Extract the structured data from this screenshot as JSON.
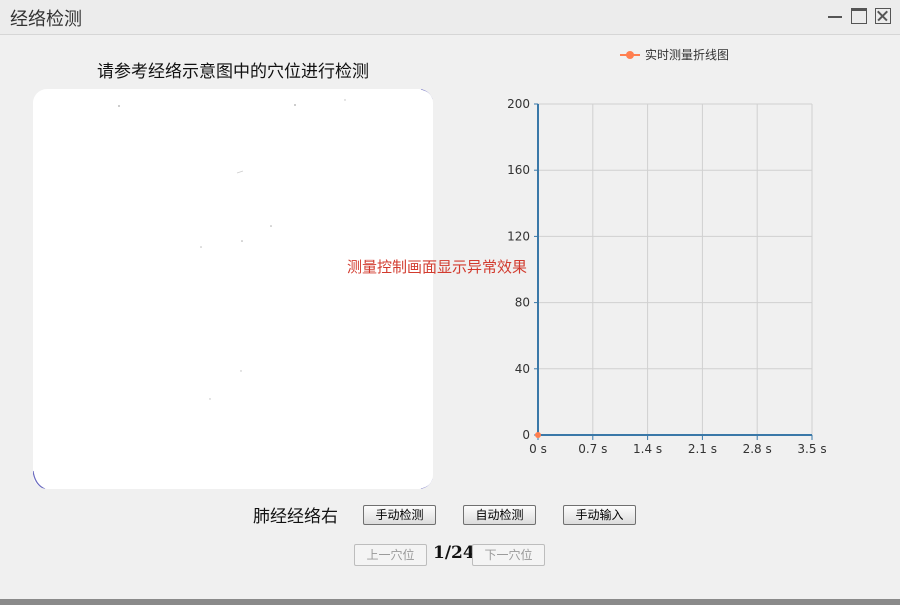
{
  "window": {
    "title": "经络检测"
  },
  "left_panel": {
    "reference_title": "请参考经络示意图中的穴位进行检测"
  },
  "error_message": "测量控制画面显示异常效果",
  "controls": {
    "meridian_label": "肺经经络右",
    "manual_detect": "手动检测",
    "auto_detect": "自动检测",
    "manual_input": "手动输入"
  },
  "navigation": {
    "prev_label": "上一穴位",
    "counter": "1/24",
    "next_label": "下一穴位"
  },
  "colors": {
    "series": "#ff7f50",
    "axis": "#3a78a8",
    "grid": "#d0d0d0",
    "error": "#d23b2e"
  },
  "chart_data": {
    "type": "line",
    "legend": [
      "实时测量折线图"
    ],
    "legend_position": "top",
    "x_ticks": [
      "0 s",
      "0.7 s",
      "1.4 s",
      "2.1 s",
      "2.8 s",
      "3.5 s"
    ],
    "y_ticks": [
      "0",
      "40",
      "80",
      "120",
      "160",
      "200"
    ],
    "xlim": [
      0,
      3.5
    ],
    "ylim": [
      0,
      200
    ],
    "grid": true,
    "series": [
      {
        "name": "实时测量折线图",
        "x": [
          0
        ],
        "y": [
          0
        ]
      }
    ]
  }
}
